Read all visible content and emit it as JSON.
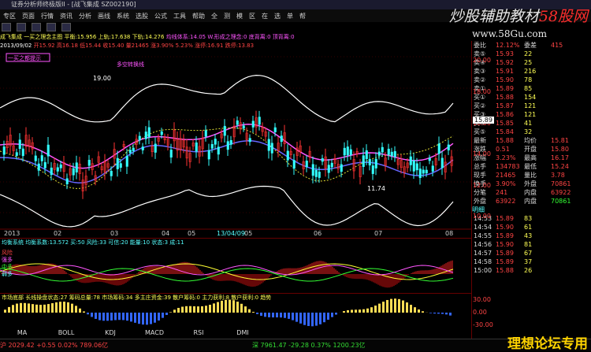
{
  "window": {
    "title": "证券分析师终极版II - [战飞集成 SZ002190]"
  },
  "menu": [
    "专区",
    "页面",
    "行情",
    "资讯",
    "分析",
    "画线",
    "系统",
    "选股",
    "公式",
    "工具",
    "帮助",
    "全",
    "测",
    "模",
    "区",
    "在",
    "选",
    "单",
    "帮"
  ],
  "watermark": {
    "main": "炒股辅助教材",
    "red": "58股网",
    "url": "www.58Gu.com",
    "bottom": "理想论坛专用"
  },
  "info": {
    "line1a": "成飞集成 一买之理念主图 平衡:15.956 上轨:17.638 下轨:14.276",
    "line1b": "均线体系:14.05 W.形成之理念:0 底背离:0 顶背离:0",
    "line2a": "2013/09/02",
    "line2b": "开15.92 高16.18 低15.44 收15.40 量21465 涨3.90% 5.23% 涨停:16.91 跌停:13.83"
  },
  "chart": {
    "price_labels": [
      "20.00",
      "18.00",
      "16.00",
      "14.00",
      "12.00",
      "10.00"
    ],
    "current_price": "15.89",
    "annotations": {
      "high": "19.00",
      "low": "11.74",
      "left_hint": "一买之都提示",
      "mid_hint": "多空转换线"
    },
    "dates": [
      "2013",
      "02",
      "03",
      "04",
      "05",
      "13/04/09",
      "05",
      "06",
      "07",
      "08"
    ]
  },
  "ind1": {
    "title": "均衡系统 均衡系数:13.572 买:50 风险:33 可信:20 能量:10 状态:3 成:11",
    "labels": [
      "风险",
      "强多",
      "中多",
      "弱多"
    ]
  },
  "ind2": {
    "title": "市场底部 长线操盘状态:27 筹码总量:78 市场筹码:34 多主庄资金:39 散户筹码:0 主力获利:8 散户获利:0 趋势",
    "labels": [
      "30.00",
      "0.00",
      "-30.00"
    ]
  },
  "tabs": [
    "MA",
    "BOLL",
    "KDJ",
    "MACD",
    "RSI",
    "DMI"
  ],
  "status": {
    "left": "沪 2029.42 +0.55 0.02% 789.06亿",
    "right": "深 7961.47 -29.28 0.37% 1200.23亿"
  },
  "quote": {
    "header": [
      "委比",
      "12.12%",
      "委差",
      "415"
    ],
    "sells": [
      [
        "卖⑤",
        "15.93",
        "22"
      ],
      [
        "卖④",
        "15.92",
        "25"
      ],
      [
        "卖③",
        "15.91",
        "216"
      ],
      [
        "卖②",
        "15.90",
        "78"
      ],
      [
        "卖①",
        "15.89",
        "85"
      ]
    ],
    "buys": [
      [
        "买①",
        "15.88",
        "154"
      ],
      [
        "买②",
        "15.87",
        "121"
      ],
      [
        "买③",
        "15.86",
        "121"
      ],
      [
        "买④",
        "15.85",
        "41"
      ],
      [
        "买⑤",
        "15.84",
        "32"
      ]
    ],
    "last": [
      "最新",
      "15.88",
      "均价",
      "15.81"
    ],
    "stats": [
      [
        "涨跌",
        "0.51",
        "开盘",
        "15.80"
      ],
      [
        "涨幅",
        "3.23%",
        "最高",
        "16.17"
      ],
      [
        "总手",
        "134783",
        "最低",
        "15.24"
      ],
      [
        "现手",
        "21465",
        "量比",
        "3.78"
      ],
      [
        "换手",
        "3.90%",
        "外盘",
        "70861"
      ],
      [
        "分笔",
        "241",
        "内盘",
        "63922"
      ]
    ],
    "vol": [
      "外盘",
      "63922",
      "内盘",
      "70861"
    ],
    "ticks": [
      [
        "14:53",
        "15.89",
        "83"
      ],
      [
        "14:54",
        "15.90",
        "61"
      ],
      [
        "14:55",
        "15.89",
        "43"
      ],
      [
        "14:56",
        "15.90",
        "81"
      ],
      [
        "14:57",
        "15.89",
        "67"
      ],
      [
        "14:58",
        "15.89",
        "37"
      ],
      [
        "15:00",
        "15.88",
        "26"
      ]
    ],
    "ticklabel": "明细"
  },
  "colors": {
    "up": "#ff3333",
    "down": "#33ffff",
    "mid": "#ff55ff",
    "upper": "#ffffff"
  }
}
